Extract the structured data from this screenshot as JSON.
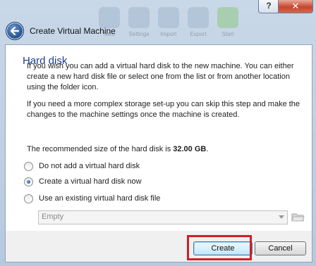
{
  "window": {
    "title": "Create Virtual Machine",
    "help_label": "?",
    "close_label": "✕",
    "background_toolbar": [
      "New",
      "Settings",
      "Import",
      "Export",
      "Start"
    ]
  },
  "page": {
    "heading": "Hard disk",
    "paragraph1": "If you wish you can add a virtual hard disk to the new machine. You can either create a new hard disk file or select one from the list or from another location using the folder icon.",
    "paragraph2": "If you need a more complex storage set-up you can skip this step and make the changes to the machine settings once the machine is created.",
    "recommended_prefix": "The recommended size of the hard disk is ",
    "recommended_size": "32.00 GB",
    "recommended_suffix": "."
  },
  "options": [
    {
      "label": "Do not add a virtual hard disk",
      "checked": false
    },
    {
      "label": "Create a virtual hard disk now",
      "checked": true
    },
    {
      "label": "Use an existing virtual hard disk file",
      "checked": false
    }
  ],
  "disk_combo": {
    "value": "Empty",
    "enabled": false
  },
  "buttons": {
    "create": "Create",
    "cancel": "Cancel"
  },
  "colors": {
    "heading": "#1d3f8e",
    "highlight": "#d01f26"
  }
}
